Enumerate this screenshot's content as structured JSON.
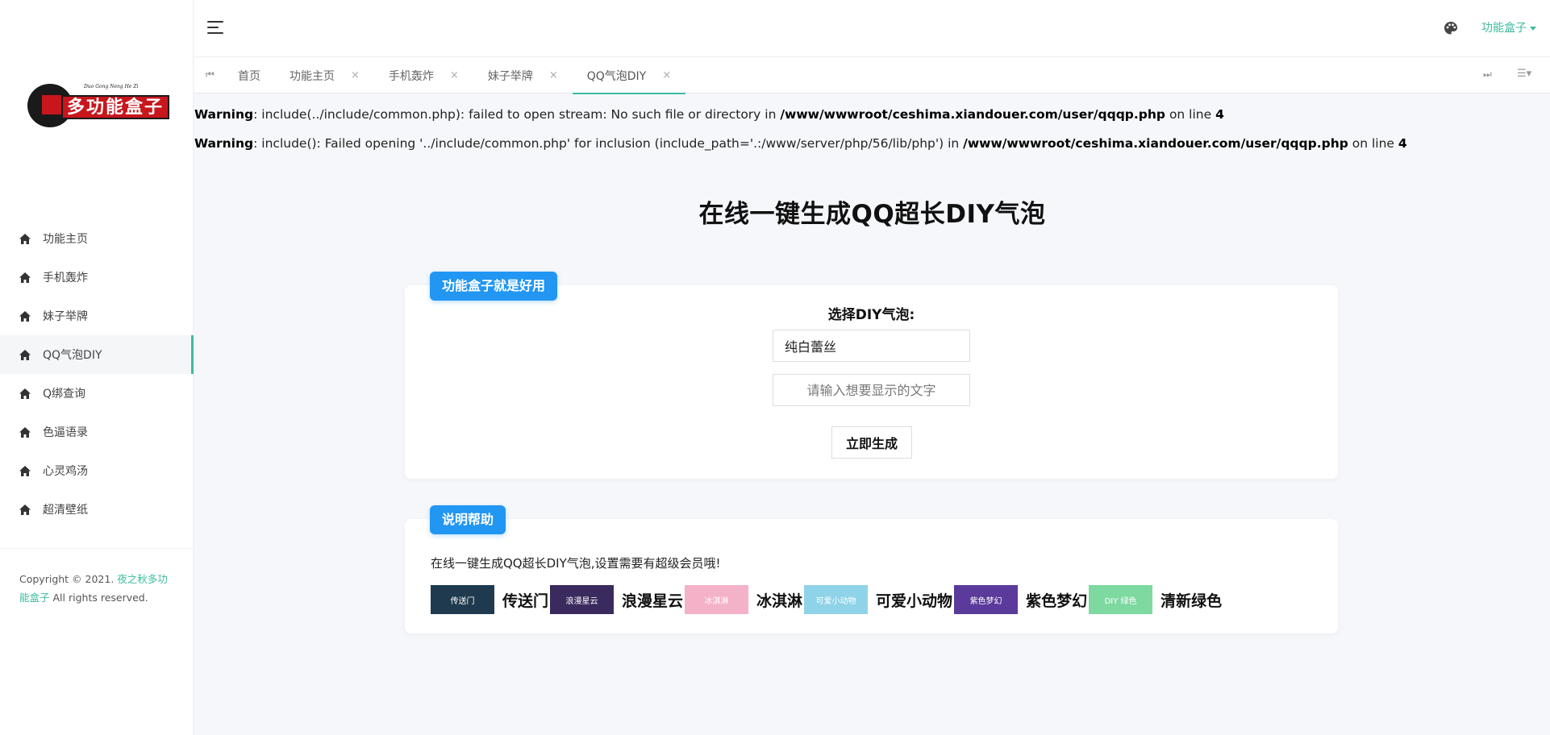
{
  "logo": {
    "text": "多功能盒子",
    "subtext": "Duo Gong Neng He Zi"
  },
  "sidebar": {
    "items": [
      {
        "label": "功能主页",
        "icon": "home-icon",
        "active": false
      },
      {
        "label": "手机轰炸",
        "icon": "home-icon",
        "active": false
      },
      {
        "label": "妹子举牌",
        "icon": "home-icon",
        "active": false
      },
      {
        "label": "QQ气泡DIY",
        "icon": "home-icon",
        "active": true
      },
      {
        "label": "Q绑查询",
        "icon": "home-icon",
        "active": false
      },
      {
        "label": "色逼语录",
        "icon": "home-icon",
        "active": false
      },
      {
        "label": "心灵鸡汤",
        "icon": "home-icon",
        "active": false
      },
      {
        "label": "超清壁纸",
        "icon": "home-icon",
        "active": false
      }
    ],
    "footer": {
      "prefix": "Copyright © 2021.",
      "link": "夜之秋多功能盒子",
      "suffix": "All rights reserved."
    }
  },
  "header": {
    "menu_icon": "hamburger-icon",
    "theme_icon": "palette-icon",
    "user_menu": "功能盒子"
  },
  "tabs": {
    "prev_icon": "⏮",
    "next_icon": "⏭",
    "more_icon": "☰▾",
    "items": [
      {
        "label": "首页",
        "closable": false,
        "active": false
      },
      {
        "label": "功能主页",
        "closable": true,
        "active": false
      },
      {
        "label": "手机轰炸",
        "closable": true,
        "active": false
      },
      {
        "label": "妹子举牌",
        "closable": true,
        "active": false
      },
      {
        "label": "QQ气泡DIY",
        "closable": true,
        "active": true
      }
    ],
    "close_glyph": "×"
  },
  "warnings": [
    {
      "label": "Warning",
      "message": ": include(../include/common.php): failed to open stream: No such file or directory in ",
      "path": "/www/wwwroot/ceshima.xiandouer.com/user/qqqp.php",
      "on_line": " on line ",
      "line": "4"
    },
    {
      "label": "Warning",
      "message": ": include(): Failed opening '../include/common.php' for inclusion (include_path='.:/www/server/php/56/lib/php') in ",
      "path": "/www/wwwroot/ceshima.xiandouer.com/user/qqqp.php",
      "on_line": " on line ",
      "line": "4"
    }
  ],
  "main": {
    "title": "在线一键生成QQ超长DIY气泡",
    "form_panel": {
      "badge": "功能盒子就是好用",
      "label": "选择DIY气泡:",
      "select_value": "纯白蕾丝",
      "input_placeholder": "请输入想要显示的文字",
      "submit": "立即生成"
    },
    "help_panel": {
      "badge": "说明帮助",
      "text": "在线一键生成QQ超长DIY气泡,设置需要有超级会员哦!",
      "samples": [
        {
          "thumb": "传送门",
          "label": "传送门",
          "color": "#1f3a4e"
        },
        {
          "thumb": "浪漫星云",
          "label": "浪漫星云",
          "color": "#3b2a5e"
        },
        {
          "thumb": "冰淇淋",
          "label": "冰淇淋",
          "color": "#f4b2c8"
        },
        {
          "thumb": "可爱小动物",
          "label": "可爱小动物",
          "color": "#8fd3e8"
        },
        {
          "thumb": "紫色梦幻",
          "label": "紫色梦幻",
          "color": "#5a3a9a"
        },
        {
          "thumb": "DIY 绿色",
          "label": "清新绿色",
          "color": "#7ed9a0"
        }
      ]
    }
  }
}
